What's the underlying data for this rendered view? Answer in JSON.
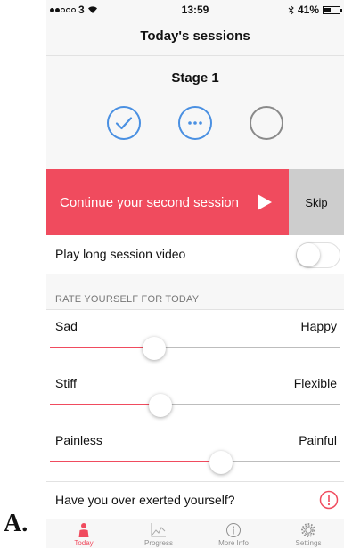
{
  "outer_label": "A.",
  "status_bar": {
    "carrier": "3",
    "time": "13:59",
    "battery_text": "41%",
    "battery_level": 0.41
  },
  "header": {
    "title": "Today's sessions"
  },
  "stage": {
    "title": "Stage 1",
    "icons": [
      "check-circle-icon",
      "ellipsis-circle-icon",
      "empty-circle-icon"
    ]
  },
  "continue_banner": {
    "label": "Continue your second session",
    "skip_label": "Skip"
  },
  "video_row": {
    "label": "Play long session video",
    "toggle_on": false
  },
  "rating": {
    "section_title": "RATE YOURSELF FOR TODAY",
    "sliders": [
      {
        "left": "Sad",
        "right": "Happy",
        "value": 0.36
      },
      {
        "left": "Stiff",
        "right": "Flexible",
        "value": 0.38
      },
      {
        "left": "Painless",
        "right": "Painful",
        "value": 0.59
      }
    ]
  },
  "exert_row": {
    "label": "Have you over exerted yourself?"
  },
  "tabs": [
    {
      "label": "Today",
      "icon": "person-icon",
      "active": true
    },
    {
      "label": "Progress",
      "icon": "chart-icon",
      "active": false
    },
    {
      "label": "More Info",
      "icon": "info-icon",
      "active": false
    },
    {
      "label": "Settings",
      "icon": "gear-icon",
      "active": false
    }
  ],
  "colors": {
    "accent": "#f04b5e",
    "blue": "#4a90e2",
    "grey_circle": "#8a8a8a",
    "skip_bg": "#cdcdcd"
  }
}
